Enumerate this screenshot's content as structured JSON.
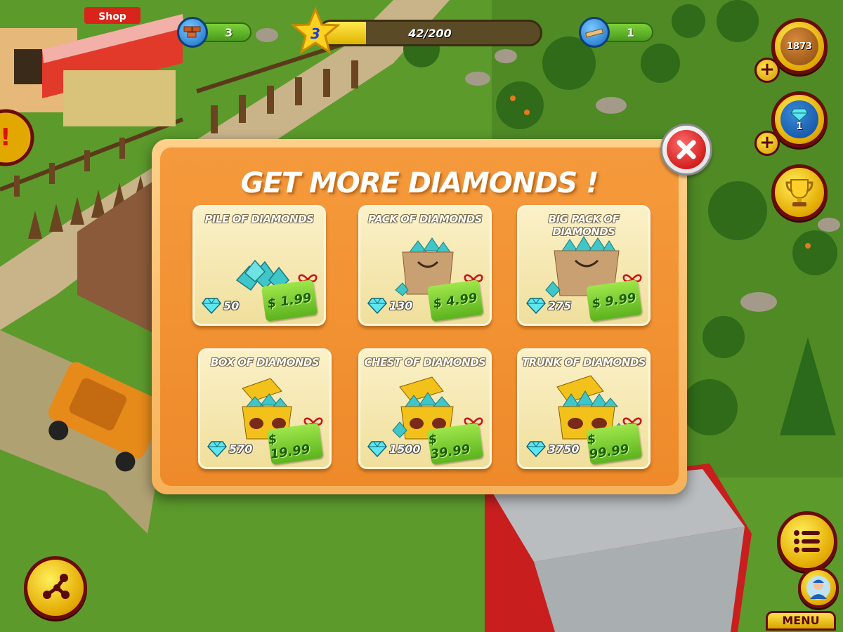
{
  "hud": {
    "bricks_count": "3",
    "level": "3",
    "xp_text": "42/200",
    "xp_progress": 0.21,
    "planks_count": "1",
    "coins": "1873",
    "diamonds": "1"
  },
  "scene": {
    "shop_sign": "Shop"
  },
  "dialog": {
    "title": "GET MORE DIAMONDS !",
    "offers": [
      {
        "name": "PILE OF DIAMONDS",
        "amount": "50",
        "price": "$ 1.99"
      },
      {
        "name": "PACK OF DIAMONDS",
        "amount": "130",
        "price": "$ 4.99"
      },
      {
        "name": "BIG PACK OF DIAMONDS",
        "amount": "275",
        "price": "$ 9.99"
      },
      {
        "name": "BOX OF DIAMONDS",
        "amount": "570",
        "price": "$ 19.99"
      },
      {
        "name": "CHEST OF DIAMONDS",
        "amount": "1500",
        "price": "$ 39.99"
      },
      {
        "name": "TRUNK OF DIAMONDS",
        "amount": "3750",
        "price": "$ 99.99"
      }
    ]
  },
  "buttons": {
    "menu_label": "MENU"
  },
  "icons": {
    "close": "close-icon",
    "diamond": "diamond-icon",
    "trophy": "trophy-icon",
    "share": "share-icon",
    "list": "list-icon",
    "avatar": "avatar-icon",
    "alert": "alert-icon"
  },
  "colors": {
    "dialog_orange": "#ee8a2a",
    "card_cream": "#fbf1c8",
    "price_green": "#5cb31e",
    "button_gold": "#e3a800",
    "button_border": "#6a0c0c"
  }
}
